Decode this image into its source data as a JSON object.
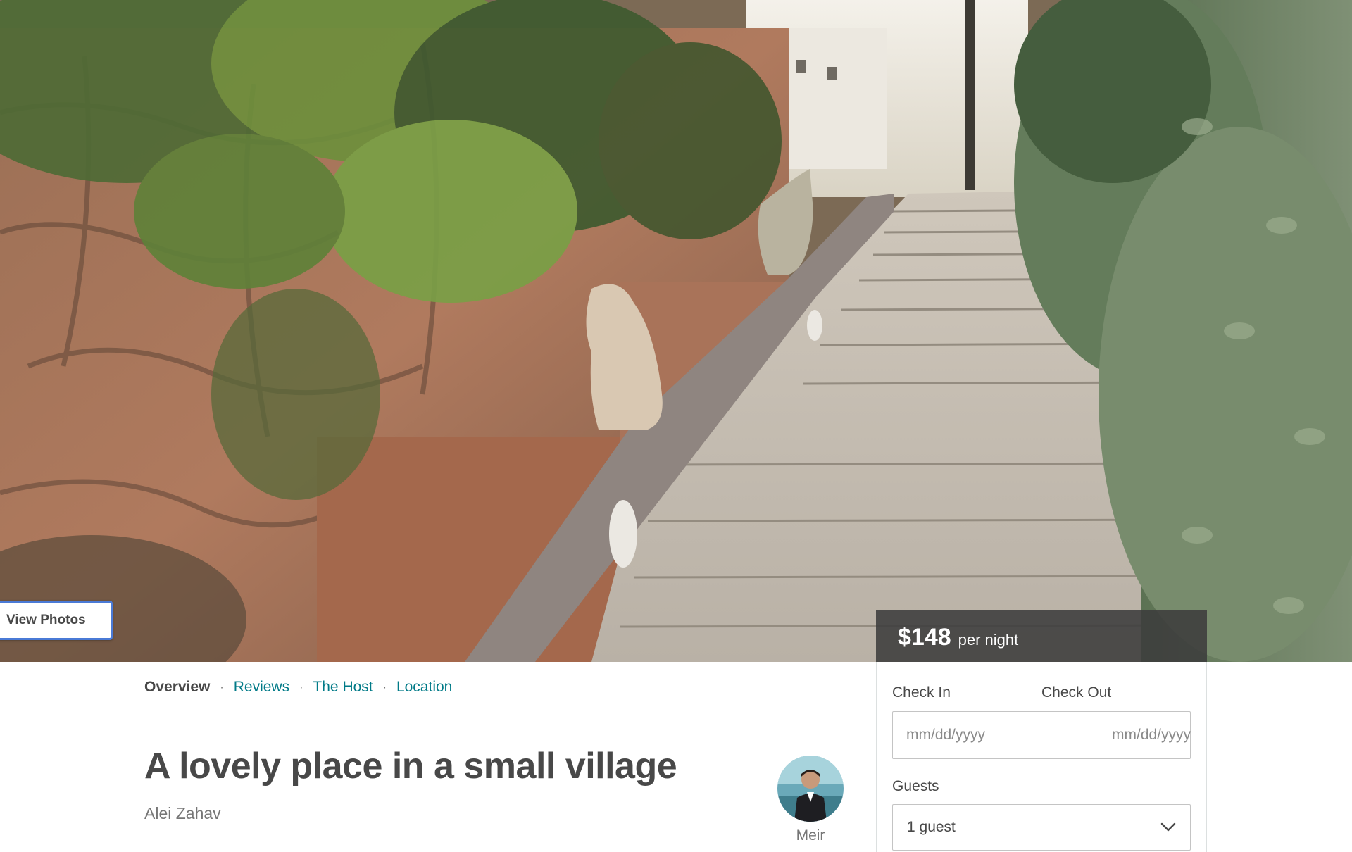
{
  "hero": {
    "view_photos_label": "View Photos"
  },
  "subnav": {
    "items": [
      {
        "label": "Overview",
        "active": true
      },
      {
        "label": "Reviews",
        "active": false
      },
      {
        "label": "The Host",
        "active": false
      },
      {
        "label": "Location",
        "active": false
      }
    ],
    "separator": "·"
  },
  "listing": {
    "title": "A lovely place in a small village",
    "location": "Alei Zahav"
  },
  "host": {
    "name": "Meir",
    "avatar_icon": "host-photo"
  },
  "booking": {
    "price": "$148",
    "price_unit": "per night",
    "check_in_label": "Check In",
    "check_out_label": "Check Out",
    "check_in_placeholder": "mm/dd/yyyy",
    "check_out_placeholder": "mm/dd/yyyy",
    "guests_label": "Guests",
    "guests_value": "1 guest",
    "dropdown_icon": "chevron-down-icon"
  },
  "colors": {
    "link": "#007a87",
    "text": "#484848",
    "muted": "#767676",
    "price_bar": "#3c3c3c",
    "focus_ring": "#4a7ad6"
  }
}
